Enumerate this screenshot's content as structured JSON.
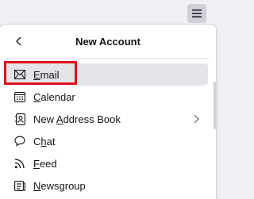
{
  "panel": {
    "title": "New Account"
  },
  "menu": {
    "items": [
      {
        "id": "email",
        "label": "Email",
        "mnemonic_index": 0,
        "icon": "mail-icon"
      },
      {
        "id": "calendar",
        "label": "Calendar",
        "mnemonic_index": 0,
        "icon": "calendar-icon"
      },
      {
        "id": "address-book",
        "label": "New Address Book",
        "mnemonic_index": 4,
        "icon": "address-book-icon",
        "has_submenu": true
      },
      {
        "id": "chat",
        "label": "Chat",
        "mnemonic_index": 1,
        "icon": "chat-icon"
      },
      {
        "id": "feed",
        "label": "Feed",
        "mnemonic_index": 0,
        "icon": "feed-icon"
      },
      {
        "id": "newsgroup",
        "label": "Newsgroup",
        "mnemonic_index": 0,
        "icon": "newsgroup-icon"
      }
    ]
  },
  "colors": {
    "highlight": "#e0101c",
    "selected_bg": "#e5e5e9",
    "text": "#15141a"
  }
}
